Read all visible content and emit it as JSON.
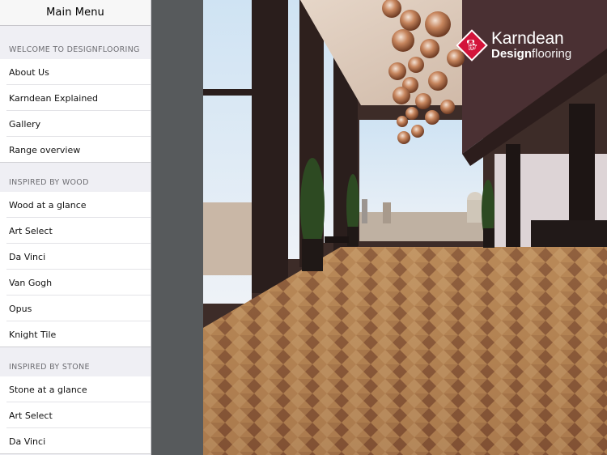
{
  "sidebar": {
    "title": "Main Menu",
    "sections": [
      {
        "header": "WELCOME TO DESIGNFLOORING",
        "items": [
          {
            "label": "About Us"
          },
          {
            "label": "Karndean Explained"
          },
          {
            "label": "Gallery"
          },
          {
            "label": "Range overview"
          }
        ]
      },
      {
        "header": "INSPIRED BY WOOD",
        "items": [
          {
            "label": "Wood at a glance"
          },
          {
            "label": "Art Select"
          },
          {
            "label": "Da Vinci"
          },
          {
            "label": "Van Gogh"
          },
          {
            "label": "Opus"
          },
          {
            "label": "Knight Tile"
          }
        ]
      },
      {
        "header": "INSPIRED BY STONE",
        "items": [
          {
            "label": "Stone at a glance"
          },
          {
            "label": "Art Select"
          },
          {
            "label": "Da Vinci"
          }
        ]
      }
    ]
  },
  "hero": {
    "image_description": "Interior with herringbone wood floor, copper pendant lights and city view",
    "brand": {
      "name_line1": "Karndean",
      "name_line2_bold": "Design",
      "name_line2_light": "flooring",
      "logo_icon": "dog-diamond-icon",
      "accent_color": "#d3143b"
    }
  }
}
